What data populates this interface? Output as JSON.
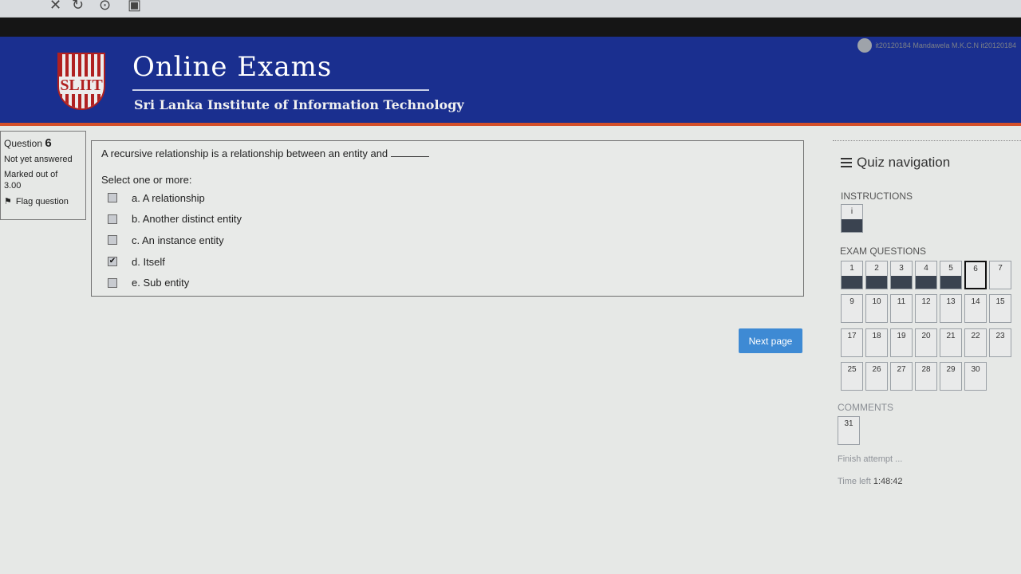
{
  "header": {
    "title": "Online Exams",
    "subtitle": "Sri Lanka Institute of Information Technology",
    "logo_text": "SLIIT",
    "user": "it20120184 Mandawela M.K.C.N it20120184"
  },
  "question_info": {
    "label": "Question",
    "number": "6",
    "status": "Not yet answered",
    "marked_label": "Marked out of",
    "marks": "3.00",
    "flag": "Flag question"
  },
  "question": {
    "text": "A recursive relationship is a relationship between an entity and",
    "prompt": "Select one or more:",
    "options": [
      {
        "label": "a. A relationship",
        "checked": false
      },
      {
        "label": "b. Another distinct entity",
        "checked": false
      },
      {
        "label": "c. An instance entity",
        "checked": false
      },
      {
        "label": "d. Itself",
        "checked": true
      },
      {
        "label": "e. Sub entity",
        "checked": false
      }
    ]
  },
  "next_button": "Next page",
  "nav": {
    "title": "Quiz navigation",
    "instructions_label": "INSTRUCTIONS",
    "instructions_button": "i",
    "exam_label": "EXAM QUESTIONS",
    "questions": [
      "1",
      "2",
      "3",
      "4",
      "5",
      "6",
      "7",
      "9",
      "10",
      "11",
      "12",
      "13",
      "14",
      "15",
      "17",
      "18",
      "19",
      "20",
      "21",
      "22",
      "23",
      "25",
      "26",
      "27",
      "28",
      "29",
      "30"
    ],
    "answered": [
      "1",
      "2",
      "3",
      "4",
      "5"
    ],
    "current": "6",
    "comments_label": "COMMENTS",
    "comments_button": "31",
    "finish": "Finish attempt ...",
    "time_label": "Time left",
    "time": "1:48:42"
  }
}
